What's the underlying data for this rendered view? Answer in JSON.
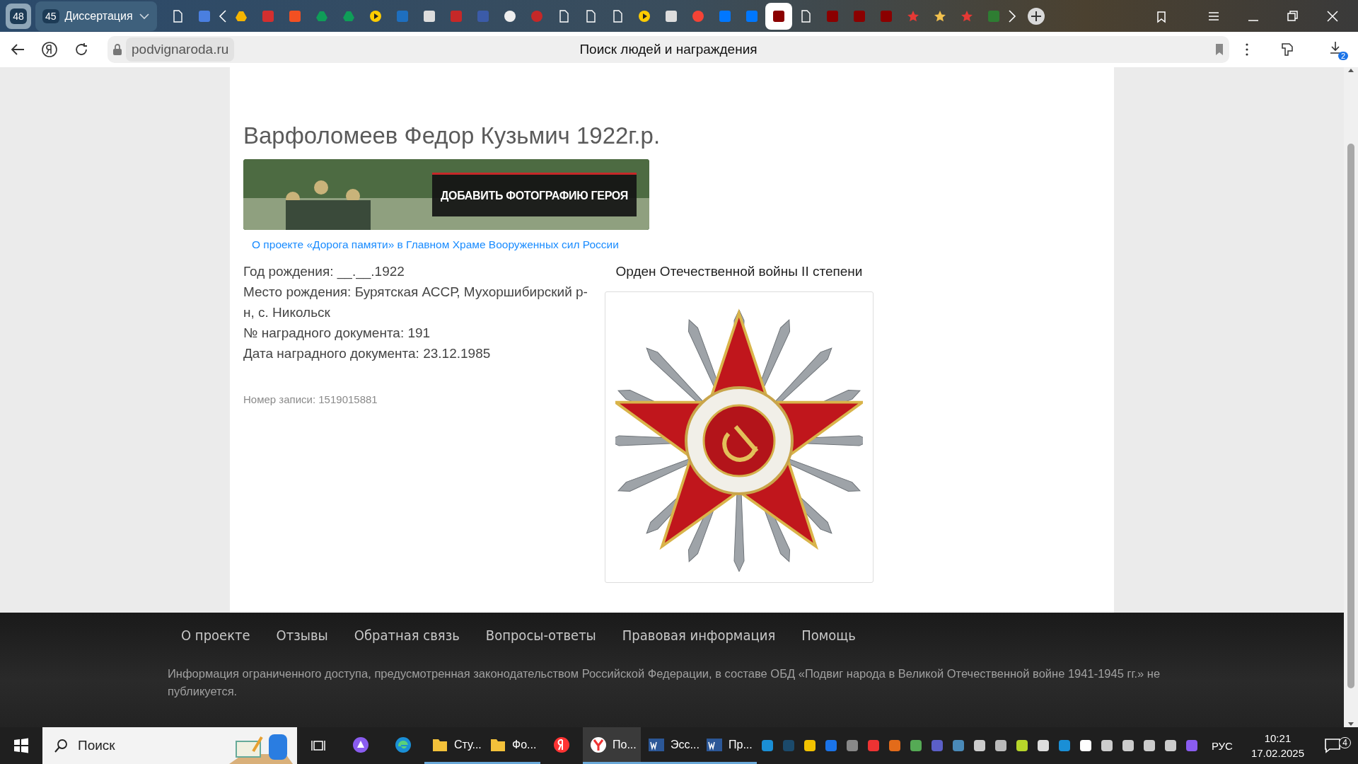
{
  "browser": {
    "group_count": "48",
    "tab_group": {
      "count": "45",
      "title": "Диссертация"
    },
    "pinned_tabs": [
      {
        "selected": false
      },
      {
        "selected": false
      },
      {
        "selected": false
      },
      {
        "selected": false
      },
      {
        "selected": false
      },
      {
        "selected": false
      },
      {
        "selected": false
      },
      {
        "selected": false
      },
      {
        "selected": false
      },
      {
        "selected": false
      },
      {
        "selected": false
      },
      {
        "selected": false
      },
      {
        "selected": false
      },
      {
        "selected": false
      },
      {
        "selected": false
      },
      {
        "selected": false
      },
      {
        "selected": false
      },
      {
        "selected": false
      },
      {
        "selected": false
      },
      {
        "selected": false
      },
      {
        "selected": false
      },
      {
        "selected": false
      },
      {
        "selected": true
      },
      {
        "selected": false
      },
      {
        "selected": false
      },
      {
        "selected": false
      },
      {
        "selected": false
      },
      {
        "selected": false
      },
      {
        "selected": false
      },
      {
        "selected": false
      },
      {
        "selected": false
      }
    ],
    "domain": "podvignaroda.ru",
    "page_title": "Поиск людей и награждения",
    "downloads_badge": "2"
  },
  "record": {
    "title": "Варфоломеев Федор Кузьмич 1922г.р.",
    "add_photo_button": "ДОБАВИТЬ ФОТОГРАФИЮ ГЕРОЯ",
    "project_link": "О проекте «Дорога памяти» в Главном Храме Вооруженных сил России",
    "details": [
      "Год рождения: __.__.1922",
      "Место рождения: Бурятская АССР, Мухоршибирский р-н, с. Никольск",
      "№ наградного документа: 191",
      "Дата наградного документа: 23.12.1985"
    ],
    "record_number": "Номер записи: 1519015881",
    "award_title": "Орден Отечественной войны II степени"
  },
  "footer": {
    "links": [
      "О проекте",
      "Отзывы",
      "Обратная связь",
      "Вопросы-ответы",
      "Правовая информация",
      "Помощь"
    ],
    "notice": "Информация ограниченного доступа, предусмотренная законодательством Российской Федерации, в составе ОБД «Подвиг народа в Великой Отечественной войне 1941-1945 гг.» не публикуется."
  },
  "taskbar": {
    "search_placeholder": "Поиск",
    "apps": [
      {
        "kind": "icon",
        "selected": false
      },
      {
        "kind": "icon",
        "selected": false
      },
      {
        "kind": "labeled",
        "label": "Сту...",
        "selected": false
      },
      {
        "kind": "labeled",
        "label": "Фо...",
        "selected": false
      },
      {
        "kind": "icon",
        "selected": false
      },
      {
        "kind": "labeled",
        "label": "По...",
        "selected": true
      },
      {
        "kind": "labeled",
        "label": "Эсс...",
        "selected": false
      },
      {
        "kind": "labeled",
        "label": "Пр...",
        "selected": false
      }
    ],
    "language": "РУС",
    "time": "10:21",
    "date": "17.02.2025",
    "notifications": "4"
  }
}
